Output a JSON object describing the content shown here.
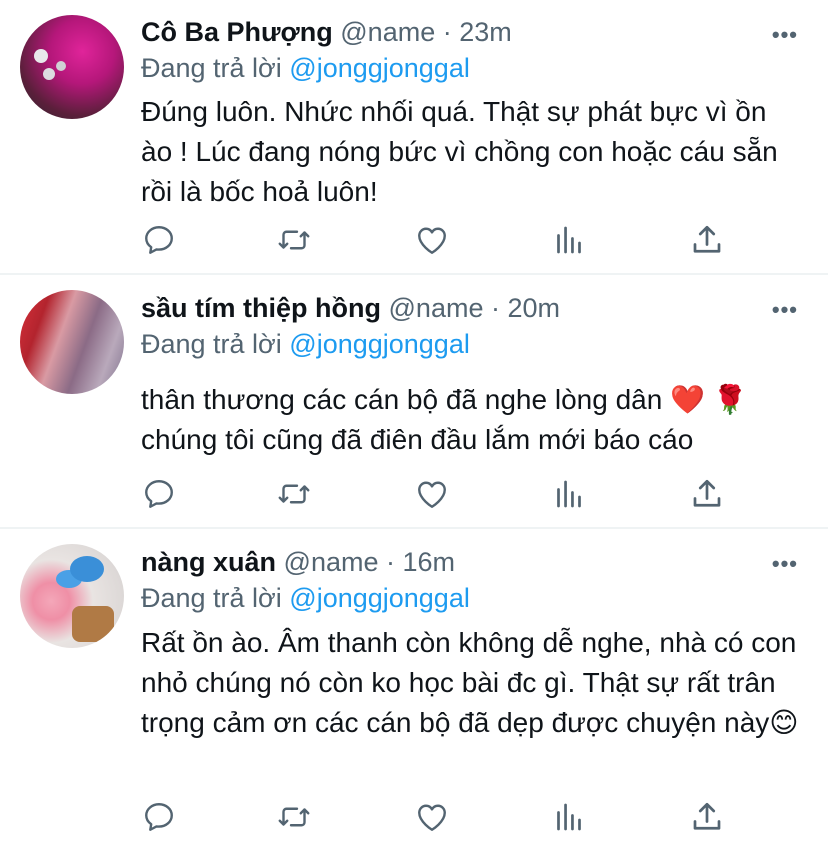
{
  "tweets": [
    {
      "display_name": "Cô Ba Phượng",
      "handle": "@name",
      "separator": "·",
      "time": "23m",
      "reply_prefix": "Đang trả lời",
      "reply_to": "@jonggjonggal",
      "text": "Đúng luôn. Nhức nhối quá. Thật sự phát bực vì ồn ào ! Lúc đang nóng bức vì chồng con hoặc cáu sẵn rồi là bốc hoả luôn!"
    },
    {
      "display_name": "sầu tím thiệp hồng",
      "handle": "@name",
      "separator": "·",
      "time": "20m",
      "reply_prefix": "Đang trả lời",
      "reply_to": "@jonggjonggal",
      "text": "thân thương các cán bộ đã nghe lòng dân ❤️ 🌹\nchúng tôi cũng đã điên đầu lắm mới báo cáo"
    },
    {
      "display_name": "nàng xuân",
      "handle": "@name",
      "separator": "·",
      "time": "16m",
      "reply_prefix": "Đang trả lời",
      "reply_to": "@jonggjonggal",
      "text": "Rất ồn ào. Âm thanh còn không dễ nghe, nhà có con nhỏ chúng nó còn ko học bài đc gì. Thật sự rất trân trọng cảm ơn các cán bộ đã dẹp được chuyện này😊"
    }
  ],
  "more_glyph": "•••",
  "icons": [
    "reply-icon",
    "retweet-icon",
    "like-icon",
    "analytics-icon",
    "share-icon",
    "more-icon"
  ],
  "colors": {
    "text": "#0f1419",
    "secondary": "#536471",
    "link": "#1d9bf0",
    "divider": "#eff3f4"
  }
}
